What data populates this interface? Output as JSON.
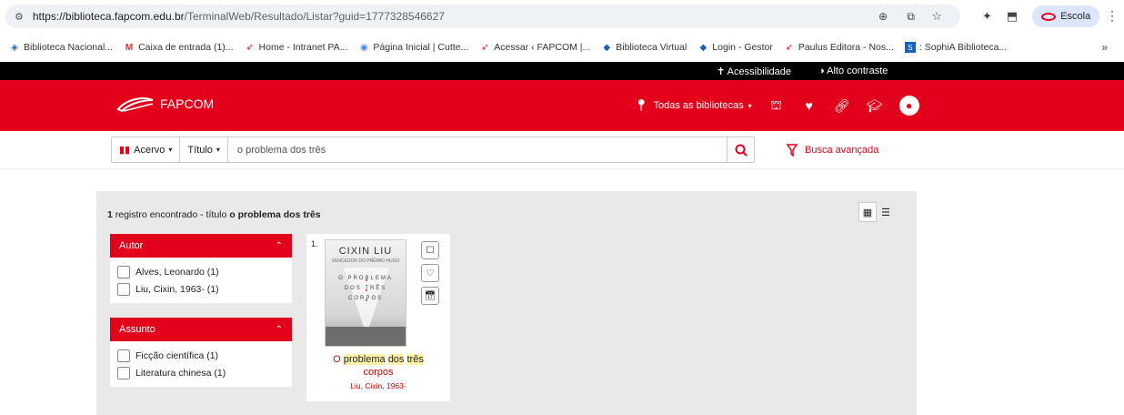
{
  "browser": {
    "url_domain": "https://biblioteca.fapcom.edu.br",
    "url_path": "/TerminalWeb/Resultado/Listar?guid=1777328546627",
    "profile_label": "Escola"
  },
  "bookmarks": [
    {
      "label": "Biblioteca Nacional..."
    },
    {
      "label": "Caixa de entrada (1)..."
    },
    {
      "label": "Home - Intranet PA..."
    },
    {
      "label": "Página Inicial | Cutte..."
    },
    {
      "label": "Acessar ‹ FAPCOM |..."
    },
    {
      "label": "Biblioteca Virtual"
    },
    {
      "label": "Login - Gestor"
    },
    {
      "label": "Paulus Editora - Nos..."
    },
    {
      "label": ": SophiA Biblioteca..."
    }
  ],
  "access_bar": {
    "accessibility": "Acessibilidade",
    "high_contrast": "Alto contraste"
  },
  "header": {
    "brand": "FAPCOM",
    "library_select": "Todas as bibliotecas",
    "brand_color": "#e3001b"
  },
  "search": {
    "collection": "Acervo",
    "field": "Título",
    "query": "o problema dos três",
    "advanced": "Busca avançada"
  },
  "results": {
    "count": "1",
    "summary_prefix": " registro encontrado - título ",
    "summary_query": "o problema dos três"
  },
  "facets": [
    {
      "title": "Autor",
      "items": [
        "Alves, Leonardo (1)",
        "Liu, Cixin, 1963- (1)"
      ]
    },
    {
      "title": "Assunto",
      "items": [
        "Ficção científica (1)",
        "Literatura chinesa (1)"
      ]
    }
  ],
  "record": {
    "index": "1.",
    "cover_author": "CIXIN LIU",
    "cover_subtitle": "VENCEDOR DO PRÊMIO HUGO",
    "cover_title_lines": [
      "O PROBLEMA",
      "DOS TRÊS",
      "CORPOS"
    ],
    "title_parts": [
      "O ",
      "problema",
      " ",
      "dos",
      " ",
      "três",
      " corpos"
    ],
    "author": "Liu, Cixin, 1963-"
  }
}
